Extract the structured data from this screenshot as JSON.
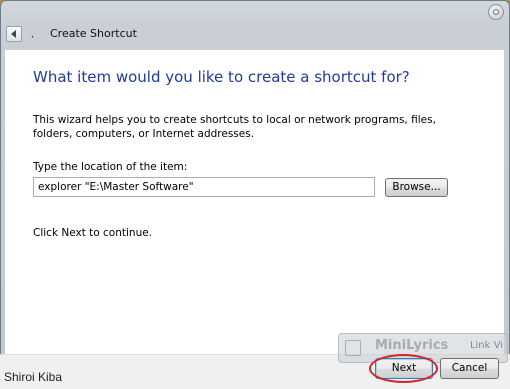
{
  "window": {
    "title": "Create Shortcut",
    "breadcrumb_dot": ","
  },
  "wizard": {
    "heading": "What item would you like to create a shortcut for?",
    "description": "This wizard helps you to create shortcuts to local or network programs, files, folders, computers, or Internet addresses.",
    "location_label": "Type the location of the item:",
    "location_value": "explorer \"E:\\Master Software\"",
    "browse_label": "Browse...",
    "continue_hint": "Click Next to continue."
  },
  "footer": {
    "next_label": "Next",
    "cancel_label": "Cancel"
  },
  "overlay": {
    "minilyrics_title": "MiniLyrics",
    "minilyrics_links": "Link  Vi"
  },
  "watermark": "Shiroi Kiba",
  "colors": {
    "heading": "#1f3c9c",
    "highlight_ring": "#d8202a"
  }
}
